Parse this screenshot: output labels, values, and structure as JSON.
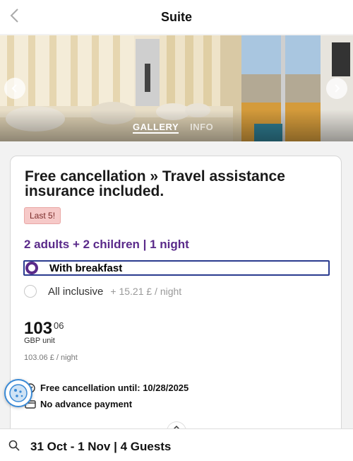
{
  "header": {
    "title": "Suite"
  },
  "gallery": {
    "tabs": [
      "GALLERY",
      "INFO"
    ],
    "active_tab": "GALLERY"
  },
  "card": {
    "title": "Free cancellation » Travel assistance insurance included.",
    "badge": "Last 5!",
    "guests": "2 adults + 2 children | 1 night",
    "options": [
      {
        "label": "With breakfast",
        "extra": "",
        "selected": true
      },
      {
        "label": "All inclusive",
        "extra": "+ 15.21 £ / night",
        "selected": false
      }
    ],
    "price": {
      "main": "103",
      "decimal": "06",
      "unit": "GBP unit",
      "per_night": "103.06 £ / night"
    },
    "features": [
      {
        "icon": "check-icon",
        "text": "Free cancellation until: 10/28/2025"
      },
      {
        "icon": "card-icon",
        "text": "No advance payment"
      }
    ]
  },
  "search": {
    "summary": "31 Oct - 1 Nov | 4 Guests"
  },
  "colors": {
    "accent": "#5a2a8a",
    "focus": "#2a3b8f",
    "badge_bg": "#f6c9c8"
  }
}
